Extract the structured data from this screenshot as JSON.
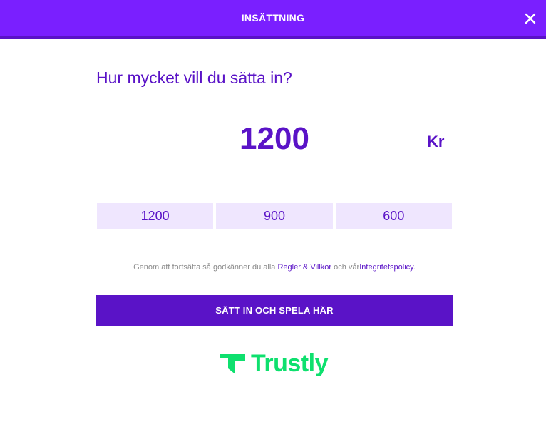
{
  "header": {
    "title": "INSÄTTNING",
    "close_icon": "close-icon"
  },
  "question": "Hur mycket vill du sätta in?",
  "amount": {
    "value": "1200",
    "currency": "Kr"
  },
  "presets": [
    "1200",
    "900",
    "600"
  ],
  "terms": {
    "prefix": "Genom att fortsätta så godkänner du alla ",
    "rules_link": "Regler & Villkor",
    "middle": " och vår",
    "privacy_link": "Integritetspolicy",
    "suffix": "."
  },
  "submit_label": "SÄTT IN OCH SPELA HÄR",
  "logo": {
    "brand": "Trustly",
    "icon": "trustly-logo-icon",
    "color": "#0ee06e"
  },
  "colors": {
    "header": "#7a1fff",
    "primary": "#5a13c7",
    "preset_bg": "#efe6fe"
  }
}
